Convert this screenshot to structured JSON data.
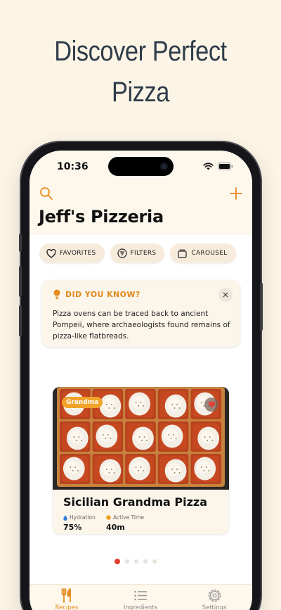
{
  "headline": {
    "line1": "Discover Perfect",
    "line2": "Pizza"
  },
  "status_bar": {
    "time": "10:36"
  },
  "header": {
    "title": "Jeff's Pizzeria",
    "search_icon": "search-icon",
    "add_icon": "plus-icon"
  },
  "chips": [
    {
      "label": "FAVORITES",
      "icon": "heart-outline-icon"
    },
    {
      "label": "FILTERS",
      "icon": "filter-icon"
    },
    {
      "label": "CAROUSEL",
      "icon": "carousel-icon"
    }
  ],
  "tip": {
    "heading": "DID YOU KNOW?",
    "body": "Pizza ovens can be traced back to ancient Pompeii, where archaeologists found remains of pizza-like flatbreads."
  },
  "card": {
    "badge": "Grandma",
    "title": "Sicilian Grandma Pizza",
    "favorited": true,
    "stats": [
      {
        "label": "Hydration",
        "value": "75%",
        "icon": "water-drop-icon"
      },
      {
        "label": "Active Time",
        "value": "40m",
        "icon": "clock-dot-icon"
      }
    ]
  },
  "pagination": {
    "total": 5,
    "active": 1
  },
  "tabs": [
    {
      "label": "Recipes",
      "icon": "fork-knife-icon",
      "active": true
    },
    {
      "label": "Ingredients",
      "icon": "list-icon",
      "active": false
    },
    {
      "label": "Settings",
      "icon": "gear-icon",
      "active": false
    }
  ],
  "colors": {
    "accent": "#e58a1b",
    "background": "#fcf5e6",
    "heading": "#2f3c4a",
    "badge": "#f2a32a",
    "active_dot": "#e23d2d"
  }
}
